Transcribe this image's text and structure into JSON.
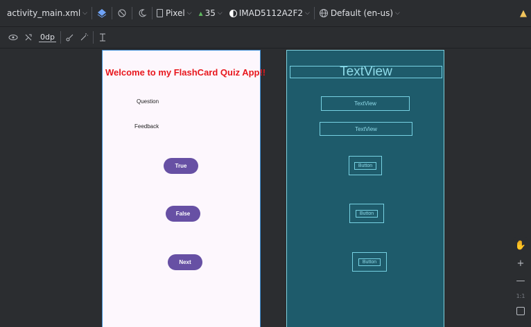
{
  "toolbar": {
    "file": "activity_main.xml",
    "device": "Pixel",
    "api": "35",
    "theme": "IMAD5112A2F2",
    "locale": "Default (en-us)",
    "margin": "0dp",
    "help": "?"
  },
  "phone": {
    "welcome": "Welcome to my FlashCard Quiz App!!",
    "question": "Question",
    "feedback": "Feedback",
    "true_btn": "True",
    "false_btn": "False",
    "next_btn": "Next"
  },
  "blueprint": {
    "title": "TextView",
    "textview1": "TextView",
    "textview2": "TextView",
    "button1": "Button",
    "button2": "Button",
    "button3": "Button"
  },
  "side": {
    "zoom_reset": "1:1"
  },
  "colors": {
    "welcome": "#e8171d",
    "button": "#6750a4",
    "blueprint_bg": "#1e5b6b"
  }
}
